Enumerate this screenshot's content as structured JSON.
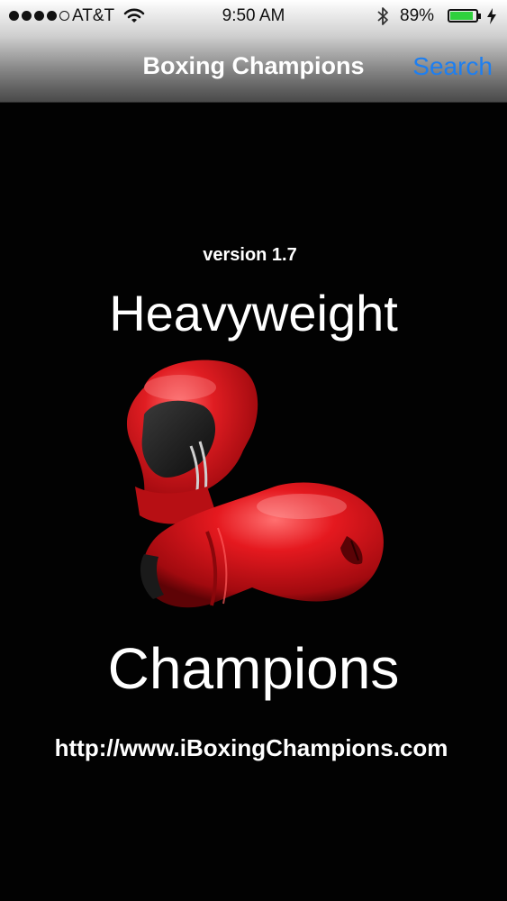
{
  "status_bar": {
    "carrier": "AT&T",
    "time": "9:50 AM",
    "battery_percent": "89%",
    "battery_level": 0.89,
    "signal_bars_filled": 4,
    "signal_bars_total": 5
  },
  "nav": {
    "title": "Boxing Champions",
    "search_label": "Search"
  },
  "content": {
    "version": "version 1.7",
    "heading_top": "Heavyweight",
    "heading_bottom": "Champions",
    "url": "http://www.iBoxingChampions.com"
  },
  "colors": {
    "accent": "#1e7ff0",
    "glove_red": "#d8141a",
    "background": "#020202",
    "battery_green": "#2fd13d"
  },
  "icons": {
    "wifi": "wifi-icon",
    "bluetooth": "bluetooth-icon",
    "charging": "charging-bolt-icon",
    "logo": "boxing-gloves-icon"
  }
}
